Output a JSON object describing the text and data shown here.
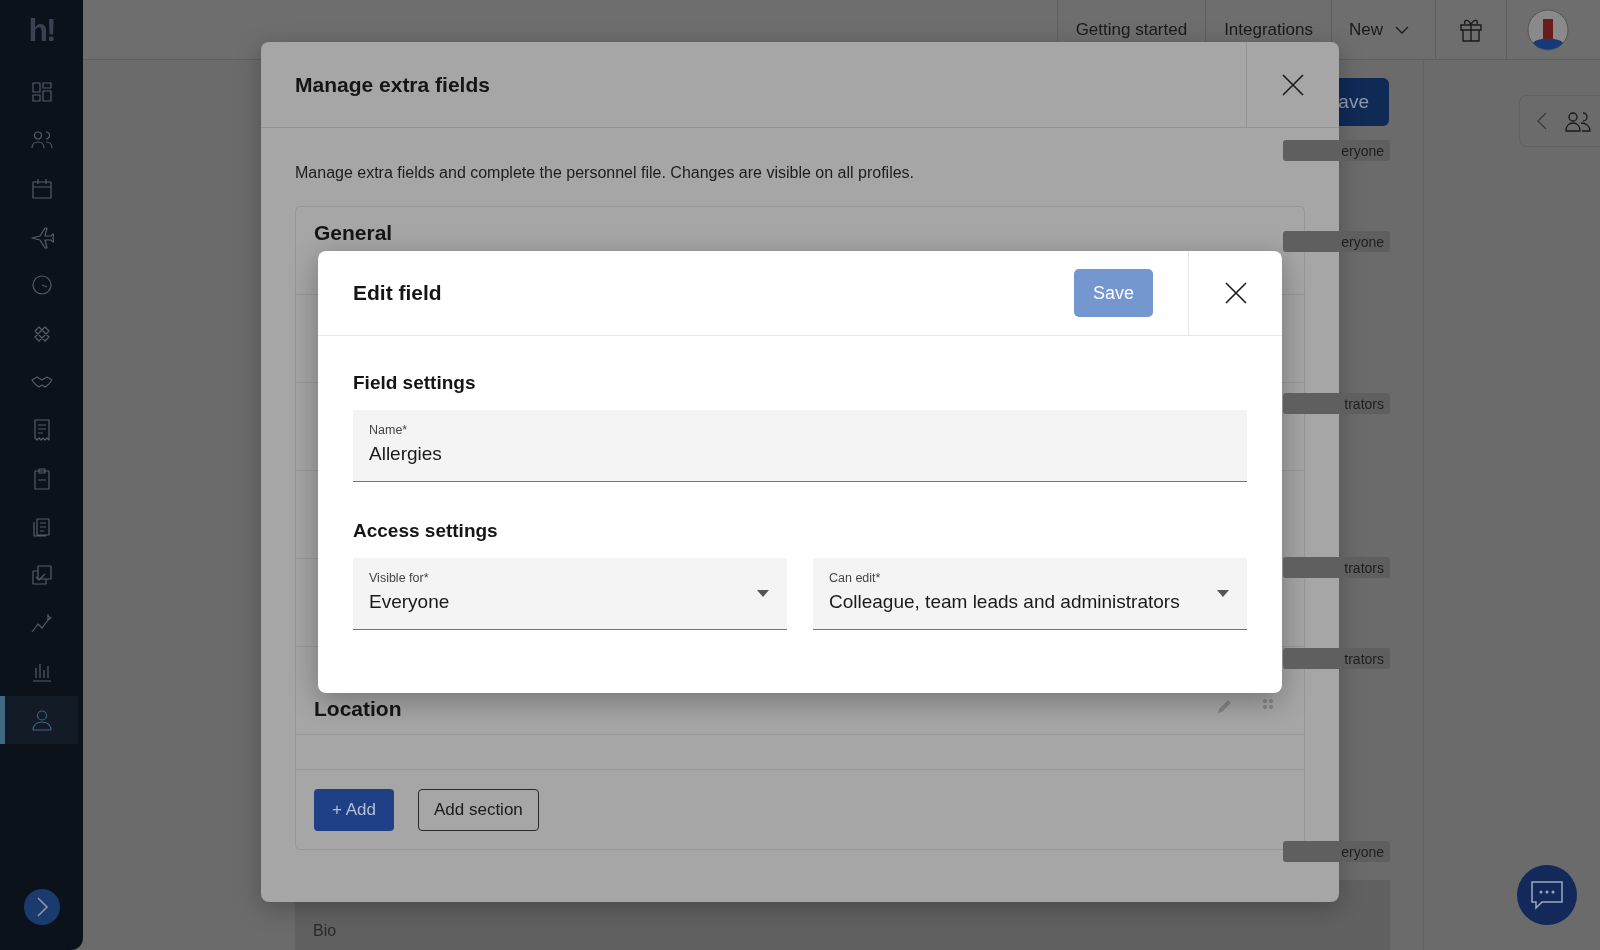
{
  "sidebar": {
    "logo": "h!",
    "items": [
      {
        "selected": false
      },
      {
        "selected": false
      },
      {
        "selected": false
      },
      {
        "selected": false
      },
      {
        "selected": false
      },
      {
        "selected": false
      },
      {
        "selected": false
      },
      {
        "selected": false
      },
      {
        "selected": false
      },
      {
        "selected": false
      },
      {
        "selected": false
      },
      {
        "selected": false
      },
      {
        "selected": false
      },
      {
        "selected": true
      }
    ]
  },
  "top_bar": {
    "links": [
      "Getting started",
      "Integrations"
    ],
    "menu": "New"
  },
  "background": {
    "save_button": "ave",
    "tags": [
      "eryone",
      "eryone",
      "trators",
      "trators",
      "trators",
      "eryone"
    ],
    "bio_label": "Bio"
  },
  "manage_dialog": {
    "title": "Manage extra fields",
    "description": "Manage extra fields and complete the personnel file. Changes are visible on all profiles.",
    "sections": [
      "General",
      "Location"
    ],
    "add_button": "+ Add",
    "add_section_button": "Add section"
  },
  "edit_dialog": {
    "title": "Edit field",
    "save": {
      "label": "Save",
      "disabled": true
    },
    "field_settings": {
      "heading": "Field settings",
      "name": {
        "label": "Name*",
        "value": "Allergies"
      }
    },
    "access_settings": {
      "heading": "Access settings",
      "selects": [
        {
          "label": "Visible for*",
          "value": "Everyone"
        },
        {
          "label": "Can edit*",
          "value": "Colleague, team leads and administrators"
        }
      ]
    }
  }
}
